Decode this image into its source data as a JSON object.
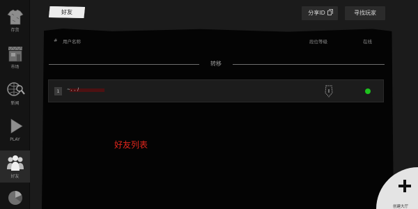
{
  "sidebar": {
    "items": [
      {
        "label": "存货",
        "icon": "shirt-icon"
      },
      {
        "label": "市场",
        "icon": "store-icon"
      },
      {
        "label": "新闻",
        "icon": "globe-search-icon"
      },
      {
        "label": "PLAY",
        "icon": "play-icon"
      },
      {
        "label": "好友",
        "icon": "friends-icon"
      },
      {
        "label": "",
        "icon": "stats-icon"
      }
    ]
  },
  "header": {
    "active_tab": "好友",
    "share_id": "分享ID",
    "find_players": "寻找玩家"
  },
  "friends_panel": {
    "columns": {
      "index": "#",
      "username": "用户名称",
      "rank": "段位等级",
      "online": "在线"
    },
    "section": "转移",
    "rows": [
      {
        "index": "1",
        "name": "~,  ,  /",
        "online": true
      }
    ],
    "caption": "好友列表"
  },
  "create_lobby": {
    "label": "创建大厅"
  },
  "colors": {
    "online": "#1ec21e",
    "caption": "#e0261c",
    "background": "#1b1b1b",
    "panel": "#040404"
  }
}
